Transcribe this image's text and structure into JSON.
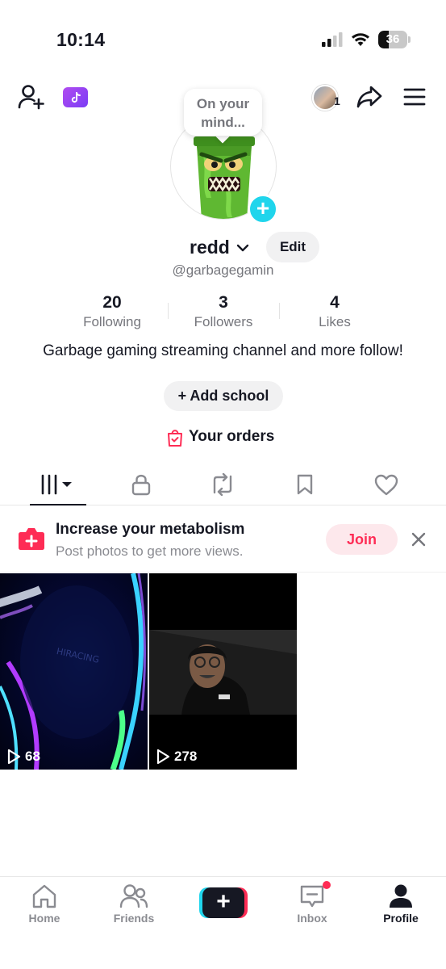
{
  "status": {
    "time": "10:14",
    "battery": "36",
    "battery_level": 0.36
  },
  "header": {
    "add_friend_icon": "person-plus-icon",
    "tiktok_icon": "tiktok-note-icon",
    "avatar_badge_count": "1",
    "share_icon": "share-arrow-icon",
    "menu_icon": "hamburger-menu-icon"
  },
  "profile": {
    "bubble_text": "On your mind...",
    "username": "redd",
    "edit_label": "Edit",
    "handle": "@garbagegamin",
    "bio": "Garbage gaming streaming channel and more follow!",
    "add_school_label": "+ Add school",
    "orders_label": "Your orders"
  },
  "stats": [
    {
      "value": "20",
      "label": "Following"
    },
    {
      "value": "3",
      "label": "Followers"
    },
    {
      "value": "4",
      "label": "Likes"
    }
  ],
  "tabs": [
    "videos-grid-icon",
    "lock-icon",
    "repost-icon",
    "bookmark-icon",
    "heart-icon"
  ],
  "promo": {
    "title": "Increase your metabolism",
    "subtitle": "Post photos to get more views.",
    "join_label": "Join"
  },
  "videos": [
    {
      "views": "68"
    },
    {
      "views": "278"
    }
  ],
  "nav": {
    "home": "Home",
    "friends": "Friends",
    "inbox": "Inbox",
    "profile": "Profile"
  },
  "colors": {
    "accent": "#fe2c55",
    "cyan": "#20d5ec",
    "text": "#161823",
    "muted": "#75767c"
  }
}
